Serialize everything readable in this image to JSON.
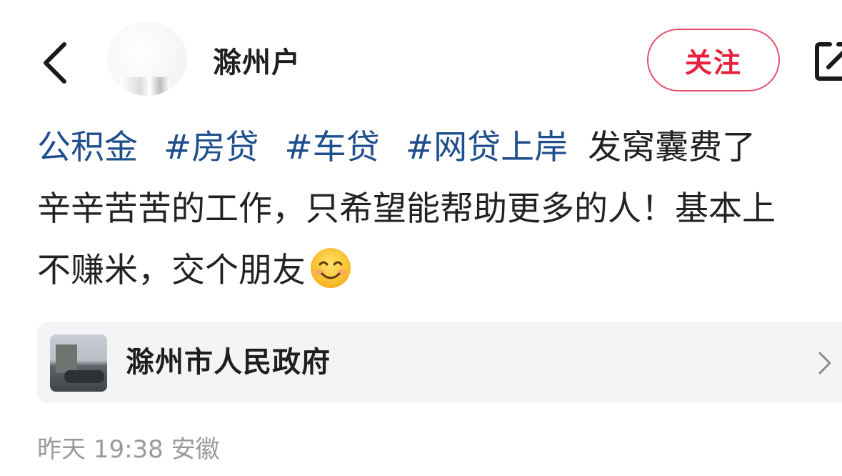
{
  "header": {
    "username": "滁州户",
    "follow_label": "关注"
  },
  "post": {
    "tags": [
      "公积金",
      "#房贷",
      "#车贷",
      "#网贷上岸"
    ],
    "line1_tail": "发窝囊费了",
    "line2": "辛辛苦苦的工作，只希望能帮助更多的人！基本上",
    "line3": "不赚米，交个朋友",
    "emoji": "smiling-face"
  },
  "location": {
    "name": "滁州市人民政府"
  },
  "meta": {
    "time": "昨天 19:38",
    "region": "安徽"
  },
  "colors": {
    "tag": "#1f4e8c",
    "follow": "#e8203e",
    "meta": "#9a9a9a",
    "card_bg": "#f4f4f6"
  },
  "icons": [
    "back-icon",
    "share-icon",
    "chevron-right-icon"
  ]
}
